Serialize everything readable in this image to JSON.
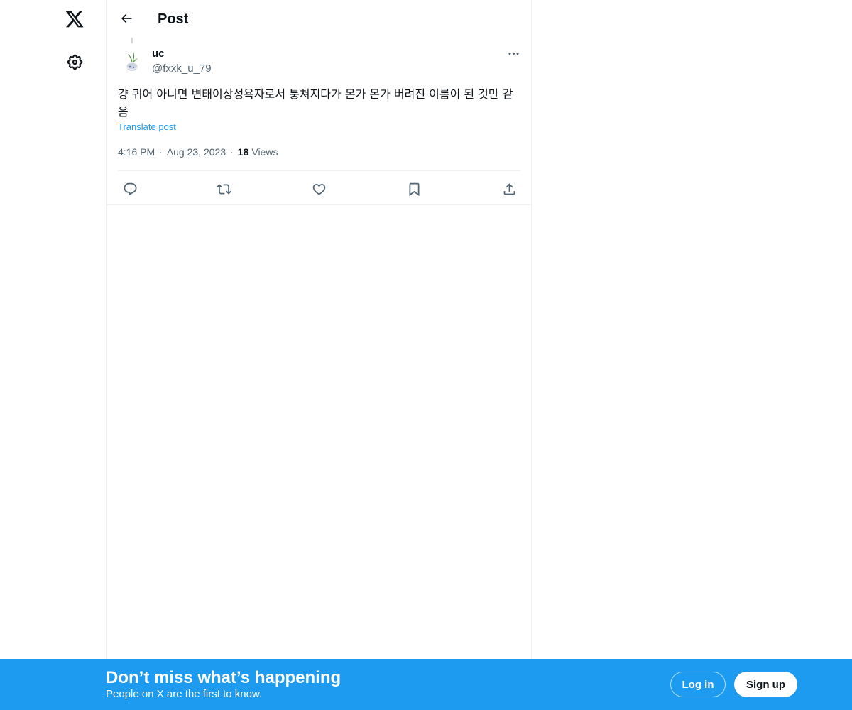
{
  "nav": {
    "logo_icon": "x-logo-icon",
    "settings_icon": "gear-icon"
  },
  "header": {
    "back_icon": "arrow-left-icon",
    "title": "Post"
  },
  "post": {
    "author": {
      "display_name": "uc",
      "handle": "@fxxk_u_79",
      "avatar": "plant-in-pot-avatar"
    },
    "text": "걍 퀴어 아니면 변태이상성욕자로서 퉁쳐지다가 몬가 몬가 버려진 이름이 된 것만 같음",
    "translate_label": "Translate post",
    "time": "4:16 PM",
    "date": "Aug 23, 2023",
    "views_count": "18",
    "views_label": "Views",
    "separator": "·",
    "actions": [
      "reply-icon",
      "repost-icon",
      "like-icon",
      "bookmark-icon",
      "share-icon"
    ]
  },
  "bottom_bar": {
    "title": "Don’t miss what’s happening",
    "subtitle": "People on X are the first to know.",
    "login_label": "Log in",
    "signup_label": "Sign up",
    "background": "#1d9bf0"
  },
  "colors": {
    "accent": "#1d9bf0",
    "text_primary": "#0f1419",
    "text_secondary": "#536471",
    "border": "#eff3f4"
  }
}
